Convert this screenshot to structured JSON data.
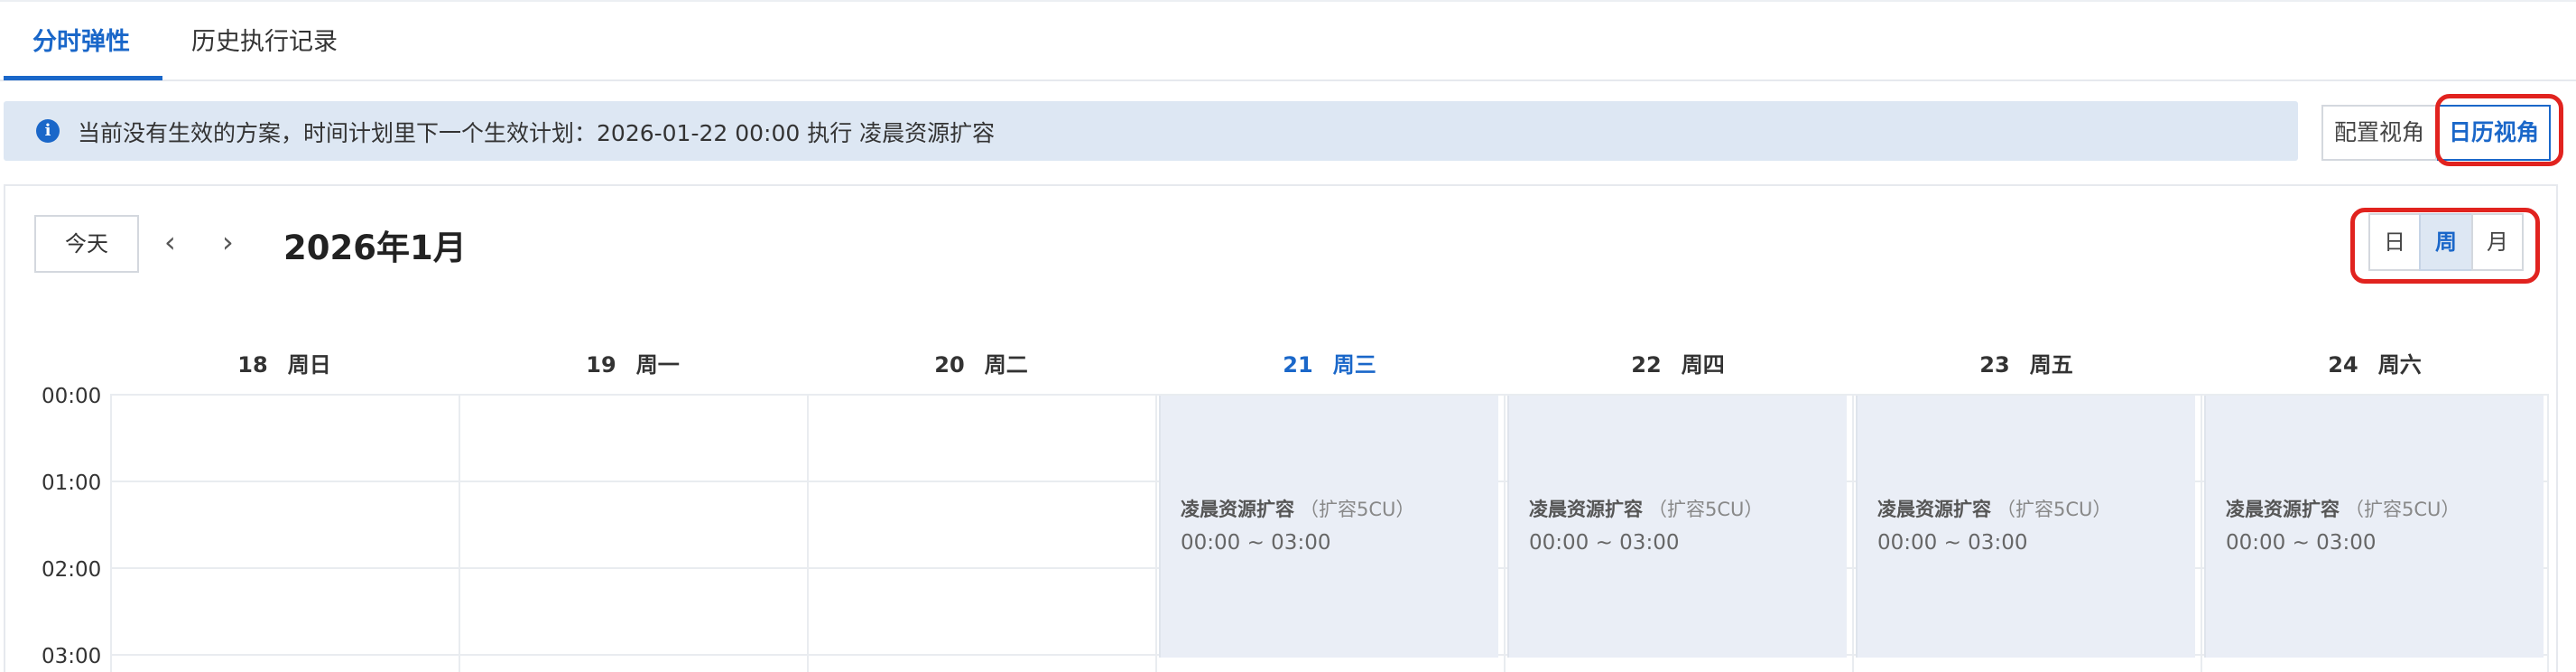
{
  "tabs": [
    {
      "label": "分时弹性",
      "active": true
    },
    {
      "label": "历史执行记录",
      "active": false
    }
  ],
  "info": {
    "icon": "info-icon",
    "text": "当前没有生效的方案，时间计划里下一个生效计划：2026-01-22 00:00 执行 凌晨资源扩容"
  },
  "view_switch": {
    "config_label": "配置视角",
    "calendar_label": "日历视角",
    "selected": "日历视角"
  },
  "calendar": {
    "today_label": "今天",
    "prev_icon": "chevron-left-icon",
    "next_icon": "chevron-right-icon",
    "month_title": "2026年1月",
    "modes": {
      "day": "日",
      "week": "周",
      "month": "月",
      "selected": "周"
    },
    "days": [
      {
        "num": "18",
        "weekday": "周日",
        "today": false
      },
      {
        "num": "19",
        "weekday": "周一",
        "today": false
      },
      {
        "num": "20",
        "weekday": "周二",
        "today": false
      },
      {
        "num": "21",
        "weekday": "周三",
        "today": true
      },
      {
        "num": "22",
        "weekday": "周四",
        "today": false
      },
      {
        "num": "23",
        "weekday": "周五",
        "today": false
      },
      {
        "num": "24",
        "weekday": "周六",
        "today": false
      }
    ],
    "times": [
      "00:00",
      "01:00",
      "02:00",
      "03:00"
    ],
    "events": [
      {
        "title": "凌晨资源扩容",
        "detail": "（扩容5CU）",
        "time": "00:00 ~ 03:00"
      },
      {
        "title": "凌晨资源扩容",
        "detail": "（扩容5CU）",
        "time": "00:00 ~ 03:00"
      },
      {
        "title": "凌晨资源扩容",
        "detail": "（扩容5CU）",
        "time": "00:00 ~ 03:00"
      },
      {
        "title": "凌晨资源扩容",
        "detail": "（扩容5CU）",
        "time": "00:00 ~ 03:00"
      }
    ]
  },
  "colors": {
    "accent": "#1a67c9",
    "highlight_ring": "#e1231f",
    "event_bg": "#eaeef6",
    "info_bg": "#dde7f3"
  }
}
